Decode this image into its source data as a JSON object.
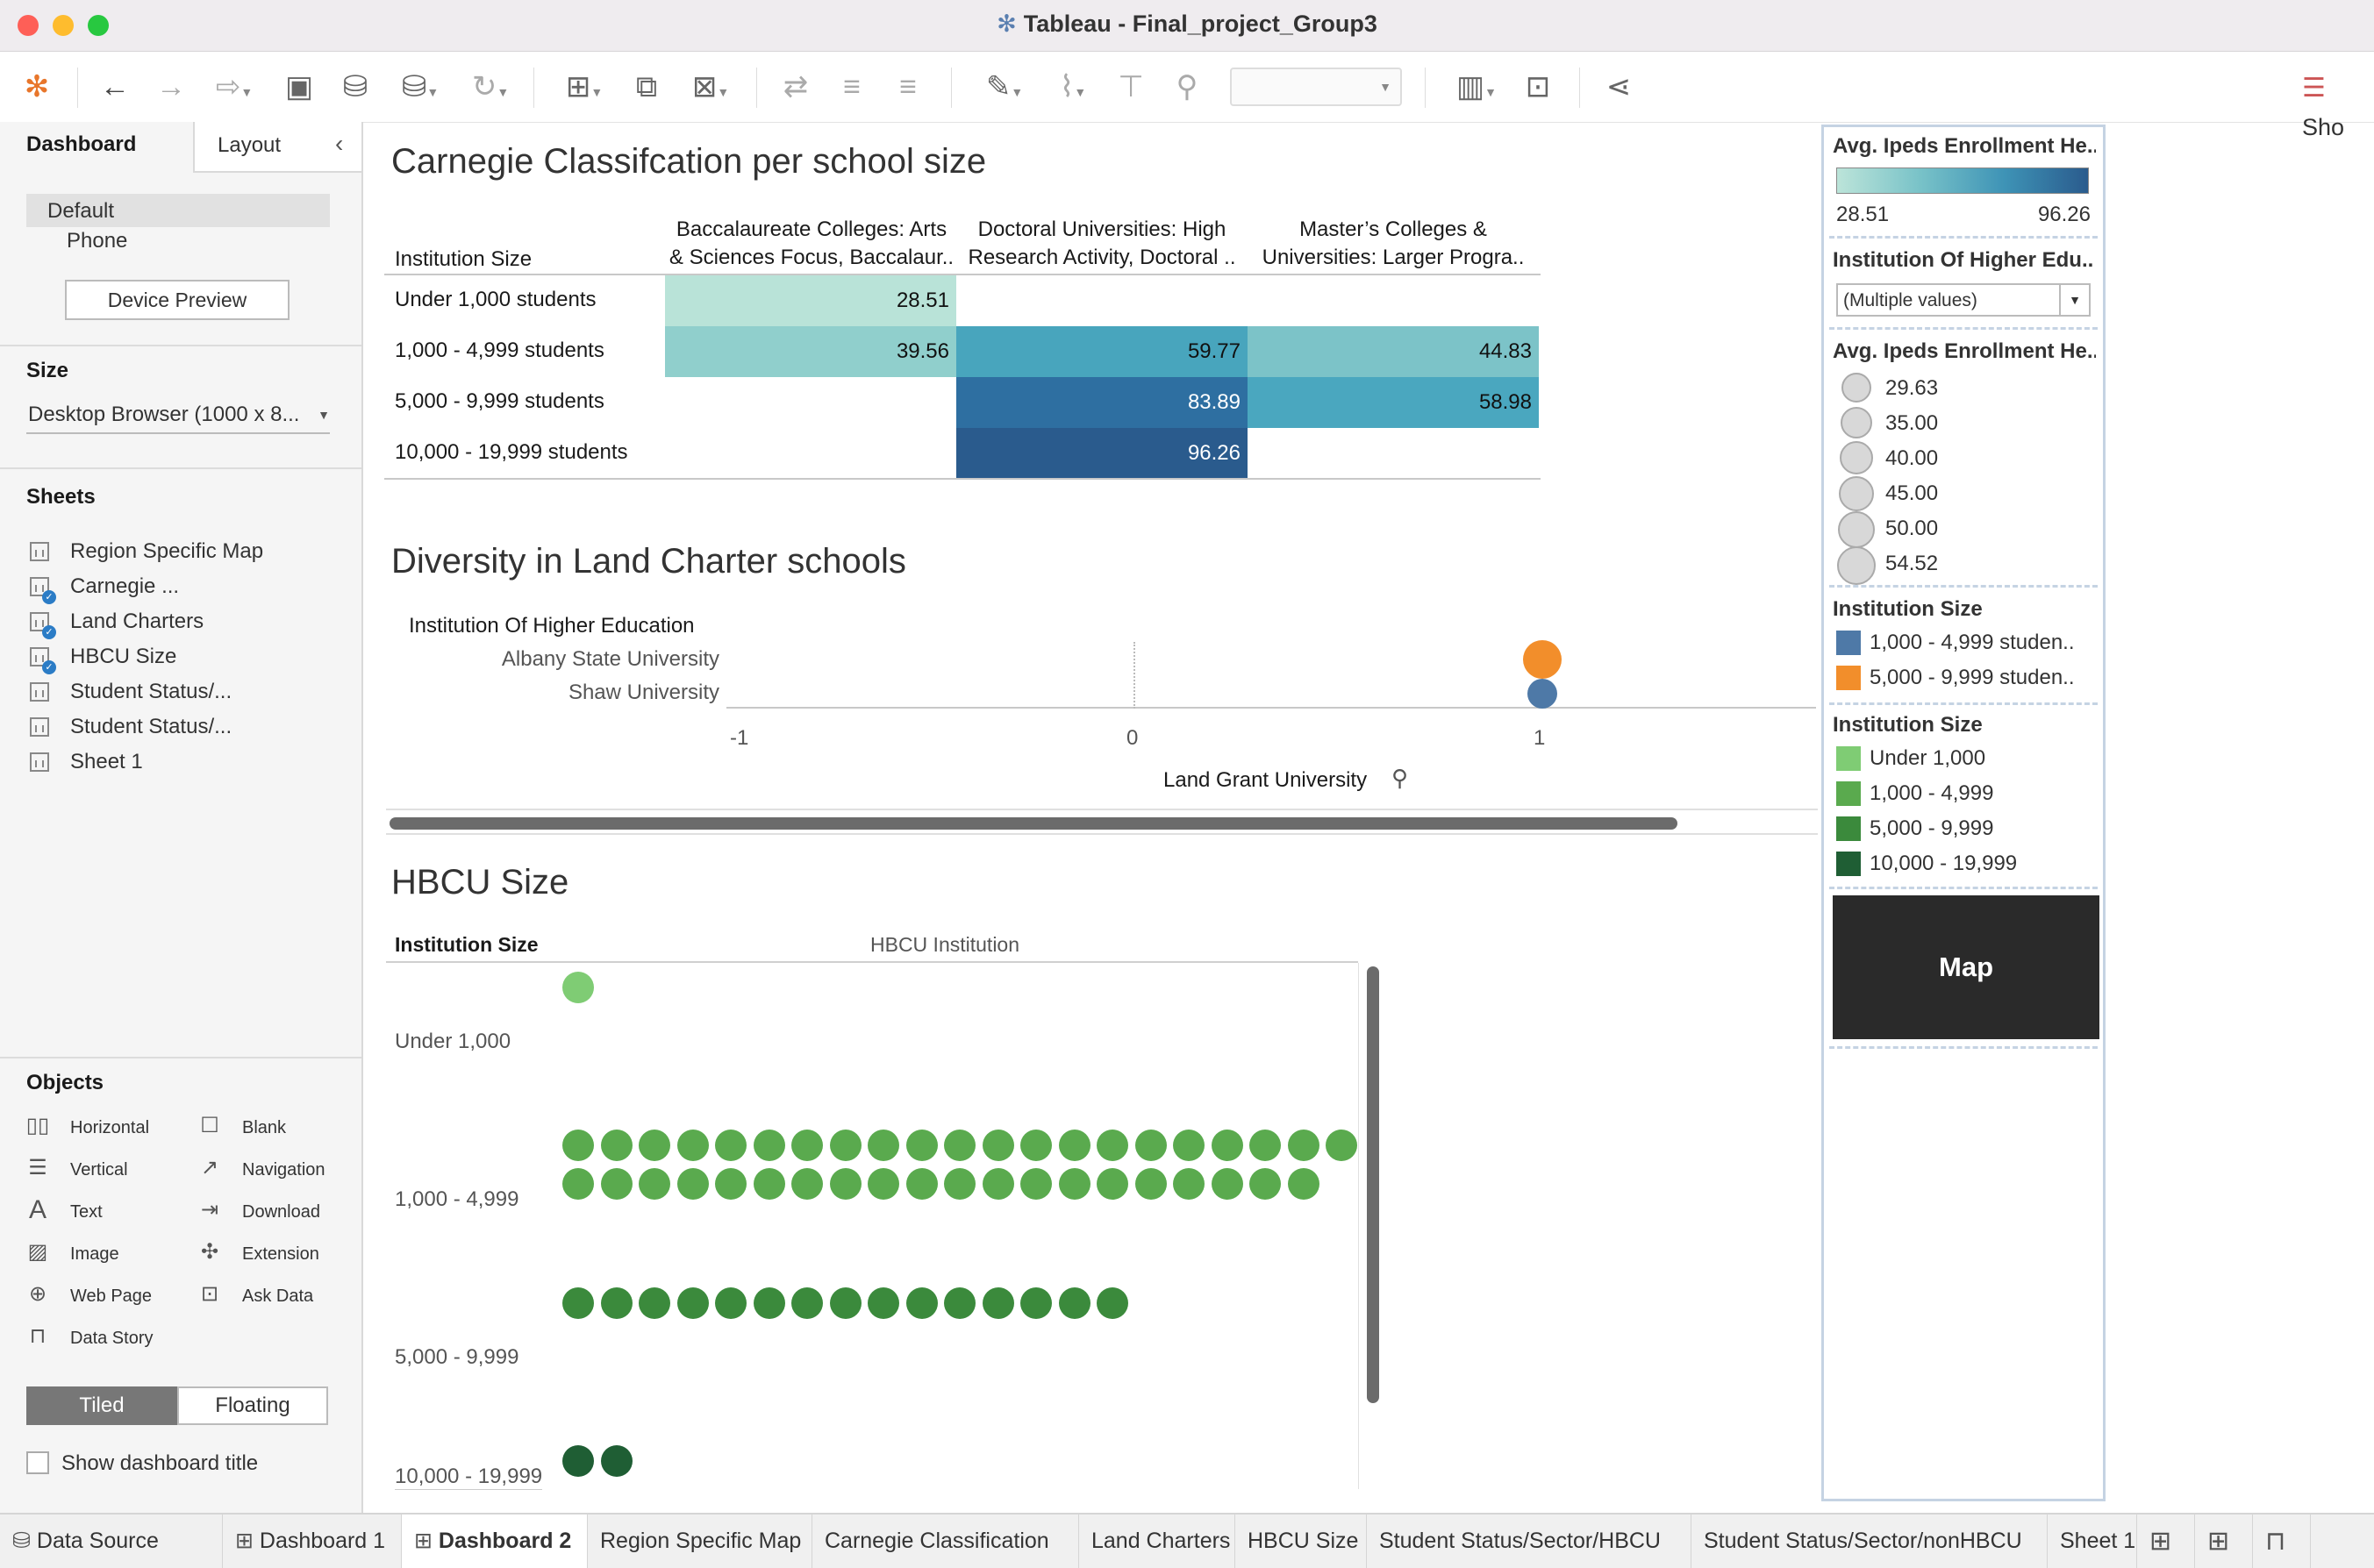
{
  "window": {
    "title": "Tableau - Final_project_Group3"
  },
  "toolbar": {
    "show_me": "Sho"
  },
  "left_panel": {
    "tabs": [
      "Dashboard",
      "Layout"
    ],
    "device_options": [
      "Default",
      "Phone"
    ],
    "device_preview_button": "Device Preview",
    "size_header": "Size",
    "size_value": "Desktop Browser (1000 x 8...",
    "sheets_header": "Sheets",
    "sheets": [
      "Region Specific Map",
      "Carnegie ...",
      "Land Charters",
      "HBCU Size",
      "Student Status/...",
      "Student Status/...",
      "Sheet 1"
    ],
    "objects_header": "Objects",
    "objects": [
      "Horizontal",
      "Blank",
      "Vertical",
      "Navigation",
      "Text",
      "Download",
      "Image",
      "Extension",
      "Web Page",
      "Ask Data",
      "Data Story"
    ],
    "tiled": "Tiled",
    "floating": "Floating",
    "show_title": "Show dashboard title"
  },
  "carnegie": {
    "title": "Carnegie Classifcation per school size",
    "row_header": "Institution Size",
    "columns": [
      [
        "Baccalaureate Colleges: Arts",
        "& Sciences Focus, Baccalaur.."
      ],
      [
        "Doctoral Universities: High",
        "Research Activity, Doctoral .."
      ],
      [
        "Master’s Colleges &",
        "Universities: Larger Progra.."
      ]
    ],
    "rows": [
      "Under 1,000 students",
      "1,000 - 4,999 students",
      "5,000 - 9,999 students",
      "10,000 - 19,999 students"
    ],
    "cells": [
      [
        "28.51",
        "",
        ""
      ],
      [
        "39.56",
        "59.77",
        "44.83"
      ],
      [
        "",
        "83.89",
        "58.98"
      ],
      [
        "",
        "96.26",
        ""
      ]
    ]
  },
  "land": {
    "title": "Diversity in Land Charter schools",
    "row_header": "Institution Of Higher Education",
    "rows": [
      "Albany State University",
      "Shaw University"
    ],
    "axis_title": "Land Grant University",
    "ticks": [
      "-1",
      "0",
      "1"
    ]
  },
  "hbcu": {
    "title": "HBCU Size",
    "row_header": "Institution Size",
    "col_header": "HBCU Institution",
    "rows": [
      "Under 1,000",
      "1,000 - 4,999",
      "5,000 - 9,999",
      "10,000 - 19,999"
    ],
    "counts": [
      1,
      41,
      15,
      2
    ],
    "colors": [
      "#7fcc74",
      "#5aaa4e",
      "#3b8a3c",
      "#1f5e34"
    ]
  },
  "legend": {
    "color_title": "Avg. Ipeds Enrollment He..",
    "color_min": "28.51",
    "color_max": "96.26",
    "filter_title": "Institution Of Higher Edu..",
    "filter_value": "(Multiple values)",
    "size_title": "Avg. Ipeds Enrollment He..",
    "size_values": [
      "29.63",
      "35.00",
      "40.00",
      "45.00",
      "50.00",
      "54.52"
    ],
    "inst_size_title": "Institution Size",
    "inst_size_items": [
      "1,000 - 4,999 studen..",
      "5,000 - 9,999 studen.."
    ],
    "inst_size_colors": [
      "#4e79a7",
      "#f28e2b"
    ],
    "hbcu_size_title": "Institution Size",
    "hbcu_size_items": [
      "Under 1,000",
      "1,000 - 4,999",
      "5,000 - 9,999",
      "10,000 - 19,999"
    ],
    "map_button": "Map"
  },
  "tabs": [
    "Data Source",
    "Dashboard 1",
    "Dashboard 2",
    "Region Specific Map",
    "Carnegie Classification",
    "Land Charters",
    "HBCU Size",
    "Student Status/Sector/HBCU",
    "Student Status/Sector/nonHBCU",
    "Sheet 1"
  ]
}
